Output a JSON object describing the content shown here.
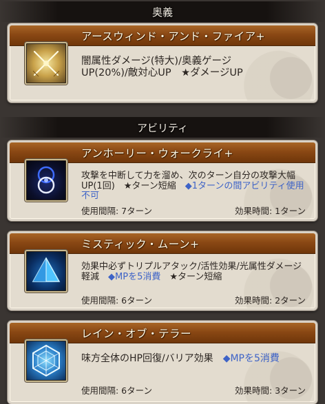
{
  "sections": {
    "ougi": "奥義",
    "ability": "アビリティ"
  },
  "ougi": {
    "name": "アースウィンド・アンド・ファイア+",
    "desc_line1": "闇属性ダメージ(特大)/奥義ゲージ",
    "desc_line2": "UP(20%)/敵対心UP　★ダメージUP",
    "icon": "crossed-swords-icon"
  },
  "abilities": [
    {
      "name": "アンホーリー・ウォークライ+",
      "desc_parts": [
        "攻撃を中断して力を溜め、次のターン自分の攻撃大幅UP(1回)　★ターン短縮　",
        "◆1ターンの間アビリティ使用不可"
      ],
      "cooldown": "使用間隔: 7ターン",
      "duration": "効果時間: 1ターン",
      "icon": "dark-rings-icon"
    },
    {
      "name": "ミスティック・ムーン+",
      "desc_parts": [
        "効果中必ずトリプルアタック/活性効果/光属性ダメージ軽減　",
        "◆MPを5消費",
        "　★ターン短縮"
      ],
      "cooldown": "使用間隔: 6ターン",
      "duration": "効果時間: 2ターン",
      "icon": "triangle-prism-icon"
    },
    {
      "name": "レイン・オブ・テラー",
      "desc_parts": [
        "味方全体のHP回復/バリア効果　",
        "◆MPを5消費"
      ],
      "cooldown": "使用間隔: 6ターン",
      "duration": "効果時間: 3ターン",
      "icon": "hexagon-barrier-icon"
    }
  ],
  "colors": {
    "title_bar": "#8a4814",
    "card_bg": "#e3dccf",
    "highlight_blue": "#3e63c7",
    "page_bg": "#3a3532"
  }
}
